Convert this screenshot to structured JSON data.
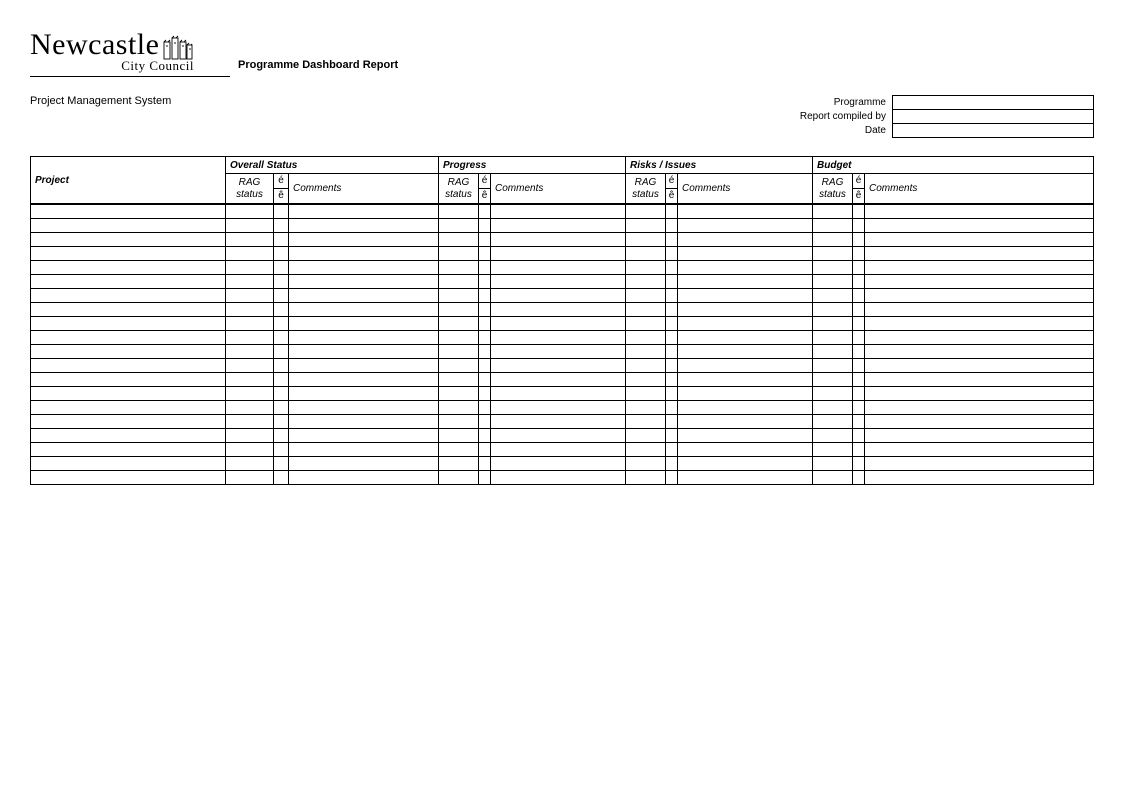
{
  "logo": {
    "name": "Newcastle",
    "sub": "City Council"
  },
  "header": {
    "report_title": "Programme Dashboard Report",
    "system_name": "Project Management System"
  },
  "meta": {
    "programme_label": "Programme",
    "compiled_label": "Report compiled by",
    "date_label": "Date",
    "programme_value": "",
    "compiled_value": "",
    "date_value": ""
  },
  "table": {
    "project_header": "Project",
    "sections": {
      "overall": "Overall Status",
      "progress": "Progress",
      "risks": "Risks / Issues",
      "budget": "Budget"
    },
    "sub": {
      "rag": "RAG status",
      "arrow_up": "é",
      "arrow_down": "ê",
      "comments": "Comments"
    },
    "row_count": 20
  }
}
